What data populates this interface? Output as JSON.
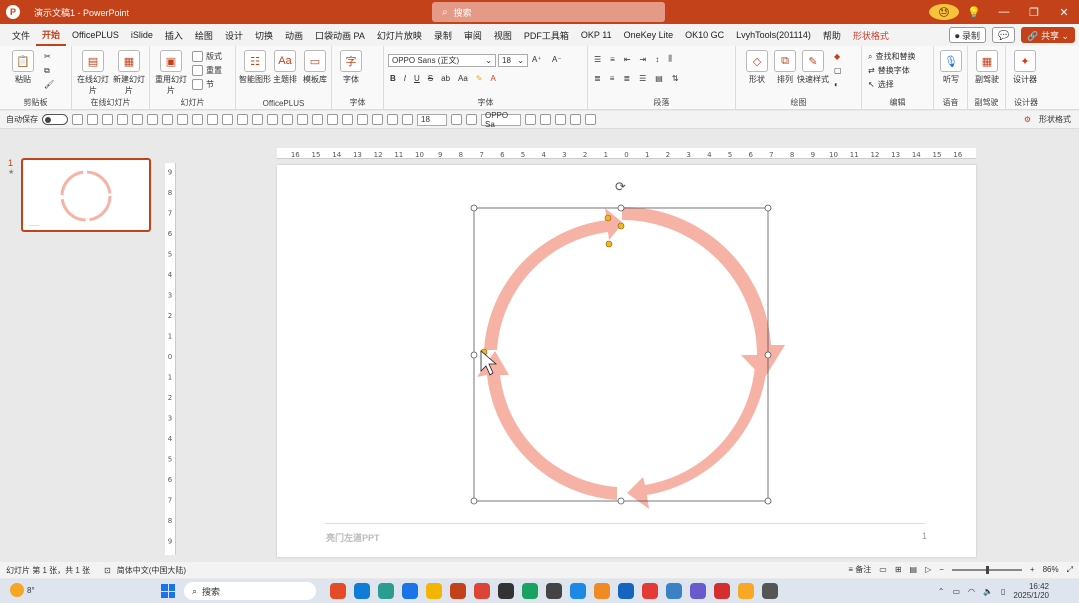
{
  "titlebar": {
    "doc_title": "演示文稿1 - PowerPoint",
    "search_placeholder": "搜索",
    "emoji": "😓",
    "minimize": "—",
    "restore": "❐",
    "close": "✕",
    "idea": "💡"
  },
  "tabs": [
    {
      "label": "文件"
    },
    {
      "label": "开始",
      "active": true
    },
    {
      "label": "OfficePLUS"
    },
    {
      "label": "iSlide"
    },
    {
      "label": "插入"
    },
    {
      "label": "绘图"
    },
    {
      "label": "设计"
    },
    {
      "label": "切换"
    },
    {
      "label": "动画"
    },
    {
      "label": "口袋动画 PA"
    },
    {
      "label": "幻灯片放映"
    },
    {
      "label": "录制"
    },
    {
      "label": "审阅"
    },
    {
      "label": "视图"
    },
    {
      "label": "PDF工具箱"
    },
    {
      "label": "OKP 11"
    },
    {
      "label": "OneKey Lite"
    },
    {
      "label": "OK10 GC"
    },
    {
      "label": "LvyhTools(201114)"
    },
    {
      "label": "帮助"
    },
    {
      "label": "形状格式",
      "red": true
    }
  ],
  "tab_actions": {
    "record": "⏺ 录制",
    "comment": "💬",
    "share": "🔗 共享 ⌄"
  },
  "ribbon": {
    "groups": {
      "clipboard": "剪贴板",
      "online": "在线幻灯片",
      "slides": "幻灯片",
      "officeplus": "OfficePLUS",
      "font": "字体",
      "paragraph": "段落",
      "drawing": "绘图",
      "editing": "编辑",
      "voice": "语音",
      "designer": "设计器"
    },
    "buttons": {
      "paste": "粘贴",
      "online_slide": "在线幻灯片",
      "new_slide": "新建幻灯片",
      "reuse_slide": "重用幻灯片",
      "layout": "版式",
      "reset": "重置",
      "section": "节",
      "smart_layout": "智能图形",
      "typeset": "主题排",
      "template": "模板库",
      "text": "字体",
      "shape": "形状",
      "arrange": "排列",
      "quick_style": "快速样式",
      "find": "查找和替换",
      "replace": "替换字体",
      "select": "选择",
      "dictate": "听写",
      "copilot": "副驾驶",
      "designer": "设计器"
    },
    "font_name": "OPPO Sans (正文)",
    "font_size": "18",
    "voice_group2": "副驾驶"
  },
  "qbar": {
    "autosave": "自动保存",
    "font_combo": "OPPO Sa",
    "size_combo": "18",
    "right_label": "形状格式"
  },
  "thumbnail": {
    "number": "1",
    "star": "★"
  },
  "slide": {
    "footer_text": "亮门左道PPT",
    "page_number": "1"
  },
  "statusbar": {
    "slide_info": "幻灯片 第 1 张，共 1 张",
    "language": "简体中文(中国大陆)",
    "accessibility": "⊡",
    "notes": "≡ 备注",
    "zoom": "86%"
  },
  "taskbar": {
    "temperature": "8°",
    "search": "搜索",
    "time": "16:42",
    "date": "2025/1/20"
  },
  "colors": {
    "accent": "#c4421a",
    "arrow": "#f7b2a6"
  }
}
